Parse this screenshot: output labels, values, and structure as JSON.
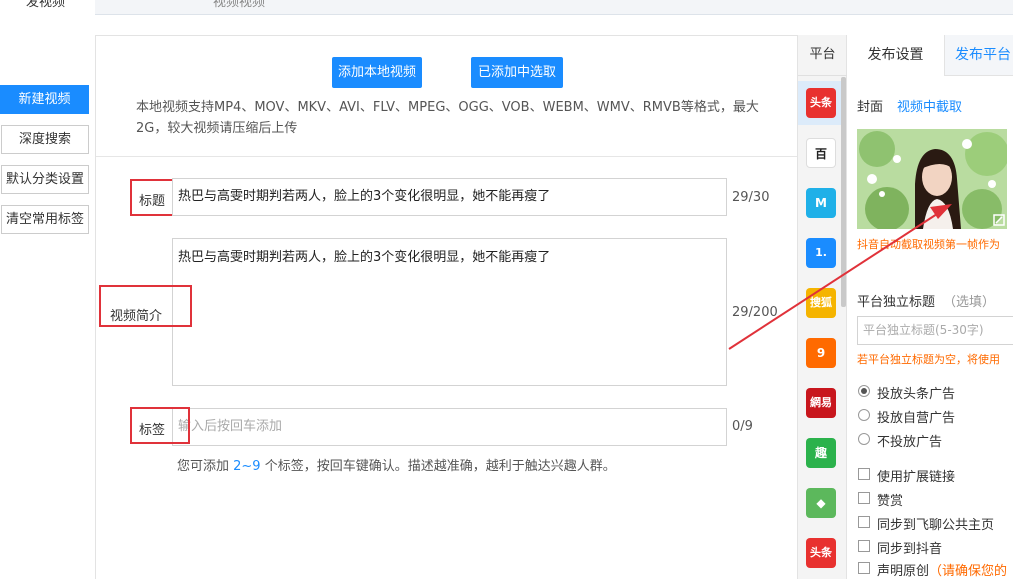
{
  "top_tabs": {
    "active": "发视频",
    "second": "视频视频"
  },
  "sidebar": {
    "new_video": "新建视频",
    "deep_search": "深度搜索",
    "default_category": "默认分类设置",
    "clear_tags": "清空常用标签"
  },
  "upload": {
    "add_local": "添加本地视频",
    "pick_added": "已添加中选取",
    "hint": "本地视频支持MP4、MOV、MKV、AVI、FLV、MPEG、OGG、VOB、WEBM、WMV、RMVB等格式，最大2G，较大视频请压缩后上传"
  },
  "form": {
    "title_label": "标题",
    "title_value": "热巴与高雯时期判若两人，脸上的3个变化很明显，她不能再瘦了",
    "title_counter": "29/30",
    "desc_label": "视频简介",
    "desc_value": "热巴与高雯时期判若两人，脸上的3个变化很明显，她不能再瘦了",
    "desc_counter": "29/200",
    "tags_label": "标签",
    "tags_placeholder": "输入后按回车添加",
    "tags_counter": "0/9",
    "tags_note_prefix": "您可添加 ",
    "tags_note_num": "2~9",
    "tags_note_suffix": " 个标签，按回车键确认。描述越准确，越利于触达兴趣人群。"
  },
  "platforms": {
    "header": "平台",
    "items": [
      {
        "name": "头条",
        "color": "#e8312f",
        "icon": "toutiao-icon"
      },
      {
        "name": "百",
        "color": "#ffffff",
        "icon": "baijiahao-icon"
      },
      {
        "name": "M",
        "color": "#1fb0e8",
        "icon": "platform-m-icon"
      },
      {
        "name": "1.",
        "color": "#1a8cff",
        "icon": "yidian-icon"
      },
      {
        "name": "搜狐",
        "color": "#f5b400",
        "icon": "sohu-icon"
      },
      {
        "name": "9",
        "color": "#ff6a00",
        "icon": "platform-swirl-icon"
      },
      {
        "name": "網易",
        "color": "#c8161d",
        "icon": "netease-icon"
      },
      {
        "name": "趣",
        "color": "#2bb24c",
        "icon": "qutoutiao-icon"
      },
      {
        "name": "◆",
        "color": "#5cb85c",
        "icon": "platform-diamond-icon"
      },
      {
        "name": "头条",
        "color": "#e8312f",
        "icon": "toutiao-2-icon"
      }
    ]
  },
  "settings": {
    "tab_active": "发布设置",
    "tab_second": "发布平台",
    "cover_label": "封面",
    "cover_link": "视频中截取",
    "cover_note": "抖音自动截取视频第一帧作为",
    "standalone_title": "平台独立标题",
    "standalone_optional": "（选填）",
    "standalone_placeholder": "平台独立标题(5-30字)",
    "standalone_note": "若平台独立标题为空，将使用",
    "ads": [
      {
        "label": "投放头条广告",
        "checked": true
      },
      {
        "label": "投放自营广告",
        "checked": false
      },
      {
        "label": "不投放广告",
        "checked": false
      }
    ],
    "options": [
      {
        "label": "使用扩展链接",
        "suffix": ""
      },
      {
        "label": "赞赏",
        "suffix": ""
      },
      {
        "label": "同步到飞聊公共主页",
        "suffix": ""
      },
      {
        "label": "同步到抖音",
        "suffix": ""
      },
      {
        "label": "声明原创",
        "suffix": "（请确保您的"
      }
    ]
  },
  "colors": {
    "accent": "#1a8cff",
    "highlight": "#e0323a",
    "warning": "#ff6a00"
  }
}
